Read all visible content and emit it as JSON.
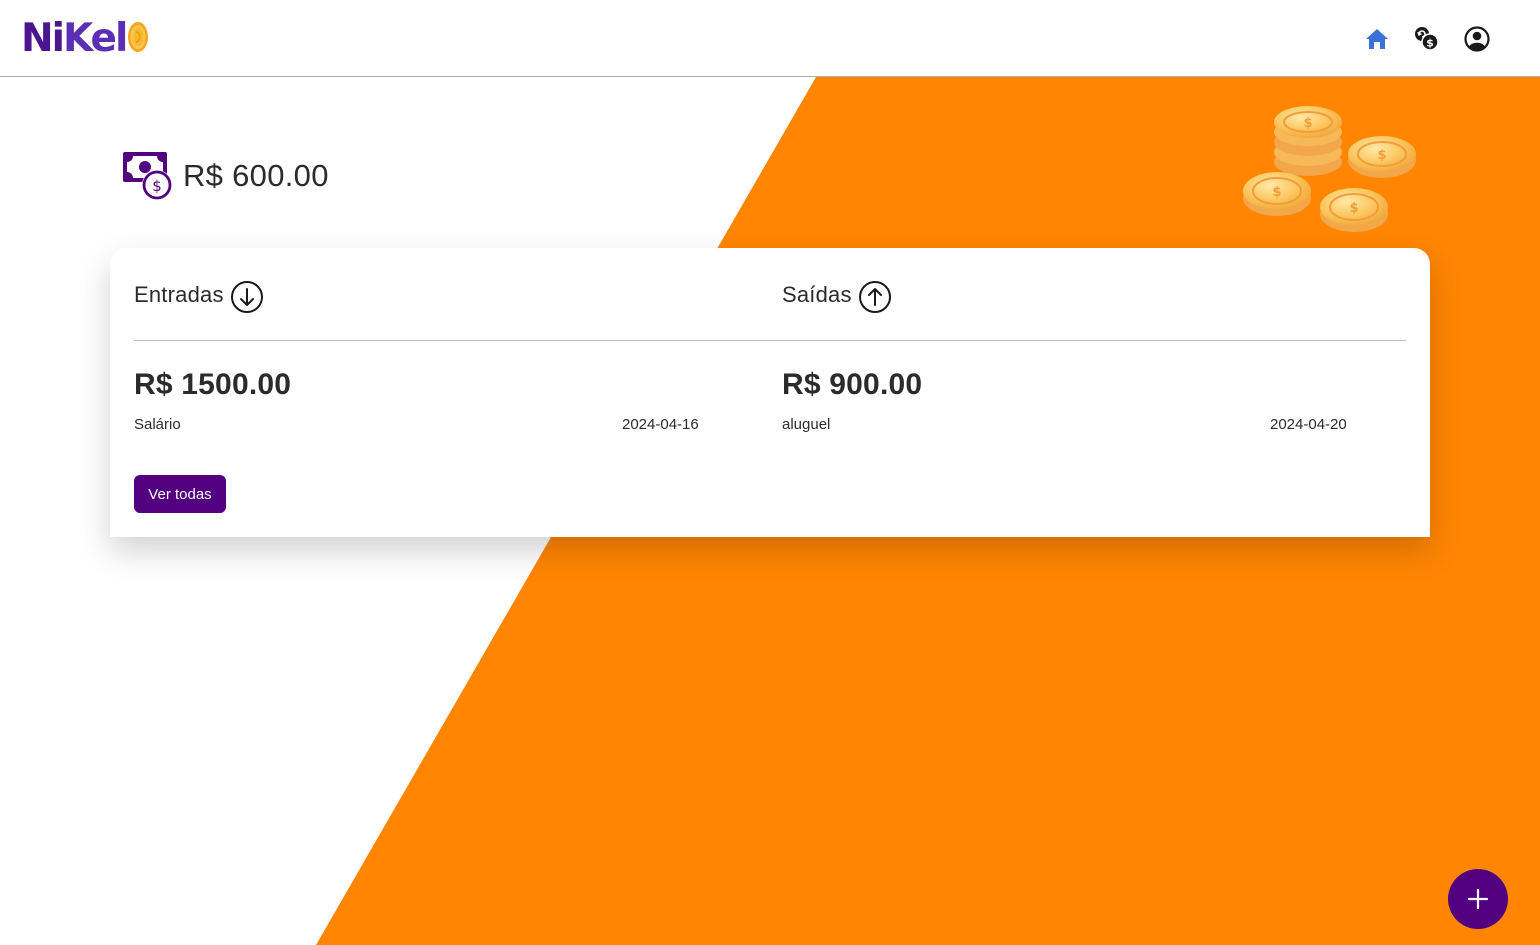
{
  "brand": {
    "logo_text_a": "Ni",
    "logo_text_b": "Kel",
    "primary_color": "#520080",
    "accent_color": "#ff8503"
  },
  "nav": {
    "icons": [
      "home-icon",
      "transactions-icon",
      "profile-icon"
    ],
    "active_icon": "home-icon",
    "active_color": "#3a73d8"
  },
  "balance": {
    "amount": "R$ 600.00",
    "icon": "money-bill-icon"
  },
  "card": {
    "entradas": {
      "title": "Entradas",
      "icon": "arrow-down-circle-icon",
      "amount": "R$ 1500.00",
      "description": "Salário",
      "date": "2024-04-16"
    },
    "saidas": {
      "title": "Saídas",
      "icon": "arrow-up-circle-icon",
      "amount": "R$ 900.00",
      "description": "aluguel",
      "date": "2024-04-20"
    },
    "view_all_label": "Ver todas"
  },
  "fab": {
    "icon": "plus-icon"
  }
}
